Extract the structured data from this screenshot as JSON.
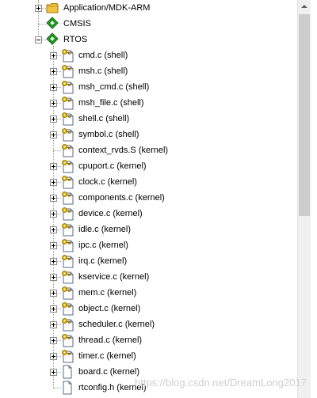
{
  "tree": {
    "items": [
      {
        "label": "Application/MDK-ARM",
        "icon": "folder-icon",
        "expander": "plus",
        "level": 1
      },
      {
        "label": "CMSIS",
        "icon": "component-diamond-icon",
        "expander": "none",
        "level": 1
      },
      {
        "label": "RTOS",
        "icon": "component-diamond-icon",
        "expander": "minus",
        "level": 1
      },
      {
        "label": "cmd.c (shell)",
        "icon": "file-key-icon",
        "expander": "plus",
        "level": 2
      },
      {
        "label": "msh.c (shell)",
        "icon": "file-key-icon",
        "expander": "plus",
        "level": 2
      },
      {
        "label": "msh_cmd.c (shell)",
        "icon": "file-key-icon",
        "expander": "plus",
        "level": 2
      },
      {
        "label": "msh_file.c (shell)",
        "icon": "file-key-icon",
        "expander": "plus",
        "level": 2
      },
      {
        "label": "shell.c (shell)",
        "icon": "file-key-icon",
        "expander": "plus",
        "level": 2
      },
      {
        "label": "symbol.c (shell)",
        "icon": "file-key-icon",
        "expander": "plus",
        "level": 2
      },
      {
        "label": "context_rvds.S (kernel)",
        "icon": "file-key-icon",
        "expander": "none",
        "level": 2
      },
      {
        "label": "cpuport.c (kernel)",
        "icon": "file-key-icon",
        "expander": "plus",
        "level": 2
      },
      {
        "label": "clock.c (kernel)",
        "icon": "file-key-icon",
        "expander": "plus",
        "level": 2
      },
      {
        "label": "components.c (kernel)",
        "icon": "file-key-icon",
        "expander": "plus",
        "level": 2
      },
      {
        "label": "device.c (kernel)",
        "icon": "file-key-icon",
        "expander": "plus",
        "level": 2
      },
      {
        "label": "idle.c (kernel)",
        "icon": "file-key-icon",
        "expander": "plus",
        "level": 2
      },
      {
        "label": "ipc.c (kernel)",
        "icon": "file-key-icon",
        "expander": "plus",
        "level": 2
      },
      {
        "label": "irq.c (kernel)",
        "icon": "file-key-icon",
        "expander": "plus",
        "level": 2
      },
      {
        "label": "kservice.c (kernel)",
        "icon": "file-key-icon",
        "expander": "plus",
        "level": 2
      },
      {
        "label": "mem.c (kernel)",
        "icon": "file-key-icon",
        "expander": "plus",
        "level": 2
      },
      {
        "label": "object.c (kernel)",
        "icon": "file-key-icon",
        "expander": "plus",
        "level": 2
      },
      {
        "label": "scheduler.c (kernel)",
        "icon": "file-key-icon",
        "expander": "plus",
        "level": 2
      },
      {
        "label": "thread.c (kernel)",
        "icon": "file-key-icon",
        "expander": "plus",
        "level": 2
      },
      {
        "label": "timer.c (kernel)",
        "icon": "file-key-icon",
        "expander": "plus",
        "level": 2
      },
      {
        "label": "board.c (kernel)",
        "icon": "file-icon",
        "expander": "plus",
        "level": 2
      },
      {
        "label": "rtconfig.h (kernel)",
        "icon": "file-icon",
        "expander": "none",
        "level": 2
      }
    ]
  },
  "watermark": "https://blog.csdn.net/DreamLong2017",
  "colors": {
    "folder": "#f0c040",
    "component": "#2aa52a",
    "key": "#e0b000",
    "file_border": "#5a6a8a"
  }
}
